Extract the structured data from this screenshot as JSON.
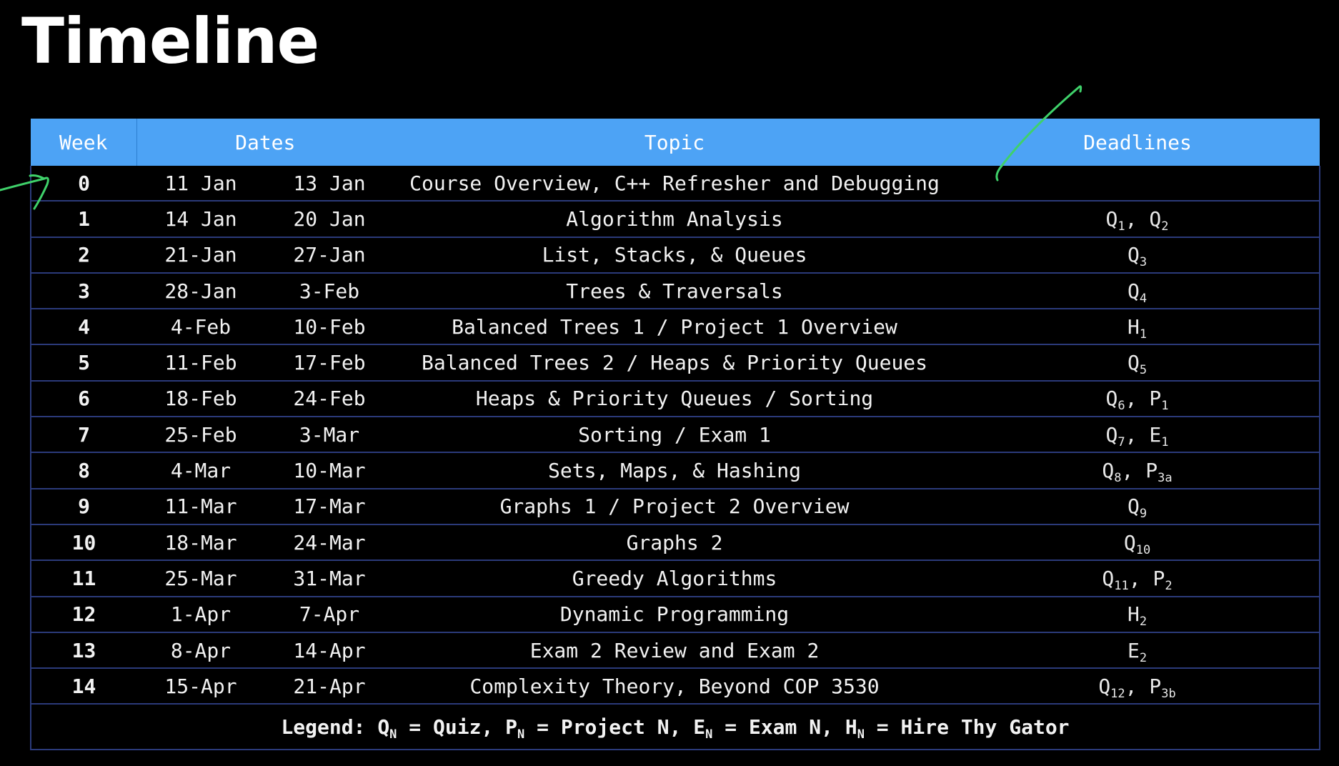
{
  "page": {
    "title": "Timeline"
  },
  "table": {
    "headers": {
      "week": "Week",
      "dates": "Dates",
      "topic": "Topic",
      "deadlines": "Deadlines"
    },
    "rows": [
      {
        "week": "0",
        "start": "11 Jan",
        "end": "13 Jan",
        "topic": "Course Overview, C++ Refresher and Debugging",
        "deadlines": []
      },
      {
        "week": "1",
        "start": "14 Jan",
        "end": "20 Jan",
        "topic": "Algorithm Analysis",
        "deadlines": [
          {
            "base": "Q",
            "sub": "1"
          },
          {
            "base": "Q",
            "sub": "2"
          }
        ]
      },
      {
        "week": "2",
        "start": "21-Jan",
        "end": "27-Jan",
        "topic": "List, Stacks, & Queues",
        "deadlines": [
          {
            "base": "Q",
            "sub": "3"
          }
        ]
      },
      {
        "week": "3",
        "start": "28-Jan",
        "end": "3-Feb",
        "topic": "Trees & Traversals",
        "deadlines": [
          {
            "base": "Q",
            "sub": "4"
          }
        ]
      },
      {
        "week": "4",
        "start": "4-Feb",
        "end": "10-Feb",
        "topic": "Balanced Trees 1 / Project 1 Overview",
        "deadlines": [
          {
            "base": "H",
            "sub": "1"
          }
        ]
      },
      {
        "week": "5",
        "start": "11-Feb",
        "end": "17-Feb",
        "topic": "Balanced Trees 2 / Heaps & Priority Queues",
        "deadlines": [
          {
            "base": "Q",
            "sub": "5"
          }
        ]
      },
      {
        "week": "6",
        "start": "18-Feb",
        "end": "24-Feb",
        "topic": "Heaps & Priority Queues / Sorting",
        "deadlines": [
          {
            "base": "Q",
            "sub": "6"
          },
          {
            "base": "P",
            "sub": "1"
          }
        ]
      },
      {
        "week": "7",
        "start": "25-Feb",
        "end": "3-Mar",
        "topic": "Sorting / Exam 1",
        "deadlines": [
          {
            "base": "Q",
            "sub": "7"
          },
          {
            "base": "E",
            "sub": "1"
          }
        ]
      },
      {
        "week": "8",
        "start": "4-Mar",
        "end": "10-Mar",
        "topic": "Sets, Maps, & Hashing",
        "deadlines": [
          {
            "base": "Q",
            "sub": "8"
          },
          {
            "base": "P",
            "sub": "3a"
          }
        ]
      },
      {
        "week": "9",
        "start": "11-Mar",
        "end": "17-Mar",
        "topic": "Graphs 1 / Project 2 Overview",
        "deadlines": [
          {
            "base": "Q",
            "sub": "9"
          }
        ]
      },
      {
        "week": "10",
        "start": "18-Mar",
        "end": "24-Mar",
        "topic": "Graphs 2",
        "deadlines": [
          {
            "base": "Q",
            "sub": "10"
          }
        ]
      },
      {
        "week": "11",
        "start": "25-Mar",
        "end": "31-Mar",
        "topic": "Greedy Algorithms",
        "deadlines": [
          {
            "base": "Q",
            "sub": "11"
          },
          {
            "base": "P",
            "sub": "2"
          }
        ]
      },
      {
        "week": "12",
        "start": "1-Apr",
        "end": "7-Apr",
        "topic": "Dynamic Programming",
        "deadlines": [
          {
            "base": "H",
            "sub": "2"
          }
        ]
      },
      {
        "week": "13",
        "start": "8-Apr",
        "end": "14-Apr",
        "topic": "Exam 2 Review and Exam 2",
        "deadlines": [
          {
            "base": "E",
            "sub": "2"
          }
        ]
      },
      {
        "week": "14",
        "start": "15-Apr",
        "end": "21-Apr",
        "topic": "Complexity Theory, Beyond COP 3530",
        "deadlines": [
          {
            "base": "Q",
            "sub": "12"
          },
          {
            "base": "P",
            "sub": "3b"
          }
        ]
      }
    ],
    "legend": {
      "prefix": "Legend: ",
      "items": [
        {
          "base": "Q",
          "sub": "N",
          "meaning": "Quiz"
        },
        {
          "base": "P",
          "sub": "N",
          "meaning": "Project N"
        },
        {
          "base": "E",
          "sub": "N",
          "meaning": "Exam N"
        },
        {
          "base": "H",
          "sub": "N",
          "meaning": "Hire Thy Gator"
        }
      ]
    }
  },
  "colors": {
    "background": "#000000",
    "header": "#4da3f5",
    "grid": "#2b3a7a",
    "annotation": "#3fd16a"
  }
}
